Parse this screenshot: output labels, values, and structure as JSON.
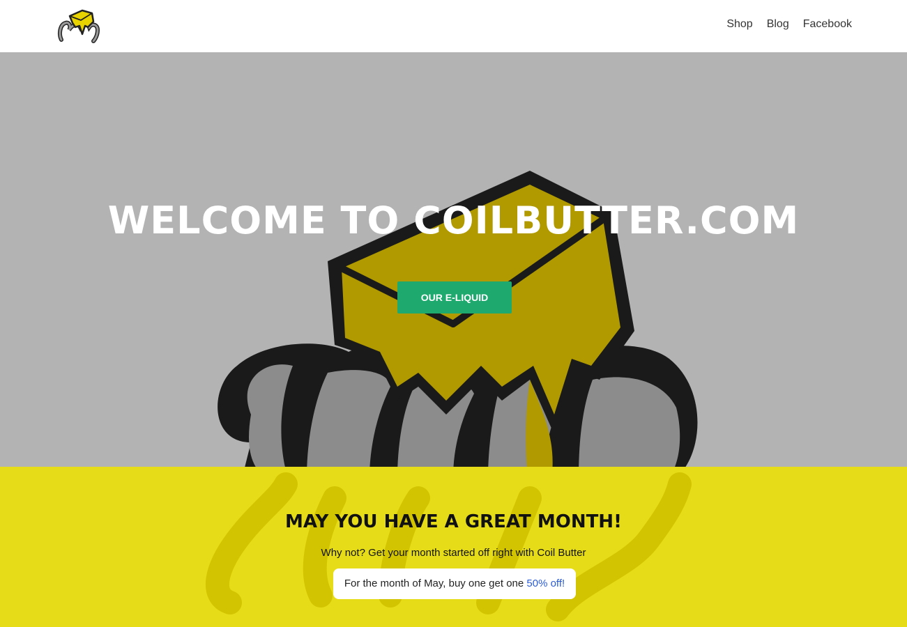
{
  "header": {
    "logo_icon": "coil-butter-logo-icon",
    "nav": [
      {
        "label": "Shop"
      },
      {
        "label": "Blog"
      },
      {
        "label": "Facebook"
      }
    ]
  },
  "hero": {
    "title": "WELCOME TO COILBUTTER.COM",
    "button_label": "OUR E-LIQUID",
    "background_art_icon": "coil-butter-logo-icon"
  },
  "promo": {
    "title": "MAY YOU HAVE A GREAT MONTH!",
    "subtitle": "Why not? Get your month started off right with Coil Butter",
    "offer_text": "For the month of May, buy one get one ",
    "offer_highlight": "50% off!"
  },
  "colors": {
    "hero_bg": "#b3b3b3",
    "promo_bg": "#e6dc17",
    "button_bg": "#1eaa6e",
    "accent_link": "#2a5bd7"
  }
}
